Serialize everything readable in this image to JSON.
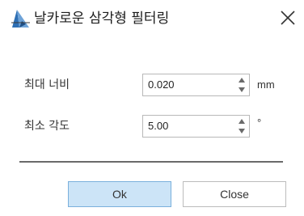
{
  "window": {
    "title": "날카로운 삼각형 필터링",
    "app_icon": "app-logo-icon",
    "close_icon": "close-icon"
  },
  "fields": [
    {
      "label": "최대 너비",
      "value": "0.020",
      "unit": "mm"
    },
    {
      "label": "최소 각도",
      "value": "5.00",
      "unit": "°"
    }
  ],
  "buttons": {
    "ok_label": "Ok",
    "close_label": "Close"
  },
  "colors": {
    "ok_background": "#cce4f7",
    "ok_border": "#7ab0dc",
    "icon_blue": "#2e6fb4",
    "divider": "#6a6a6a"
  }
}
